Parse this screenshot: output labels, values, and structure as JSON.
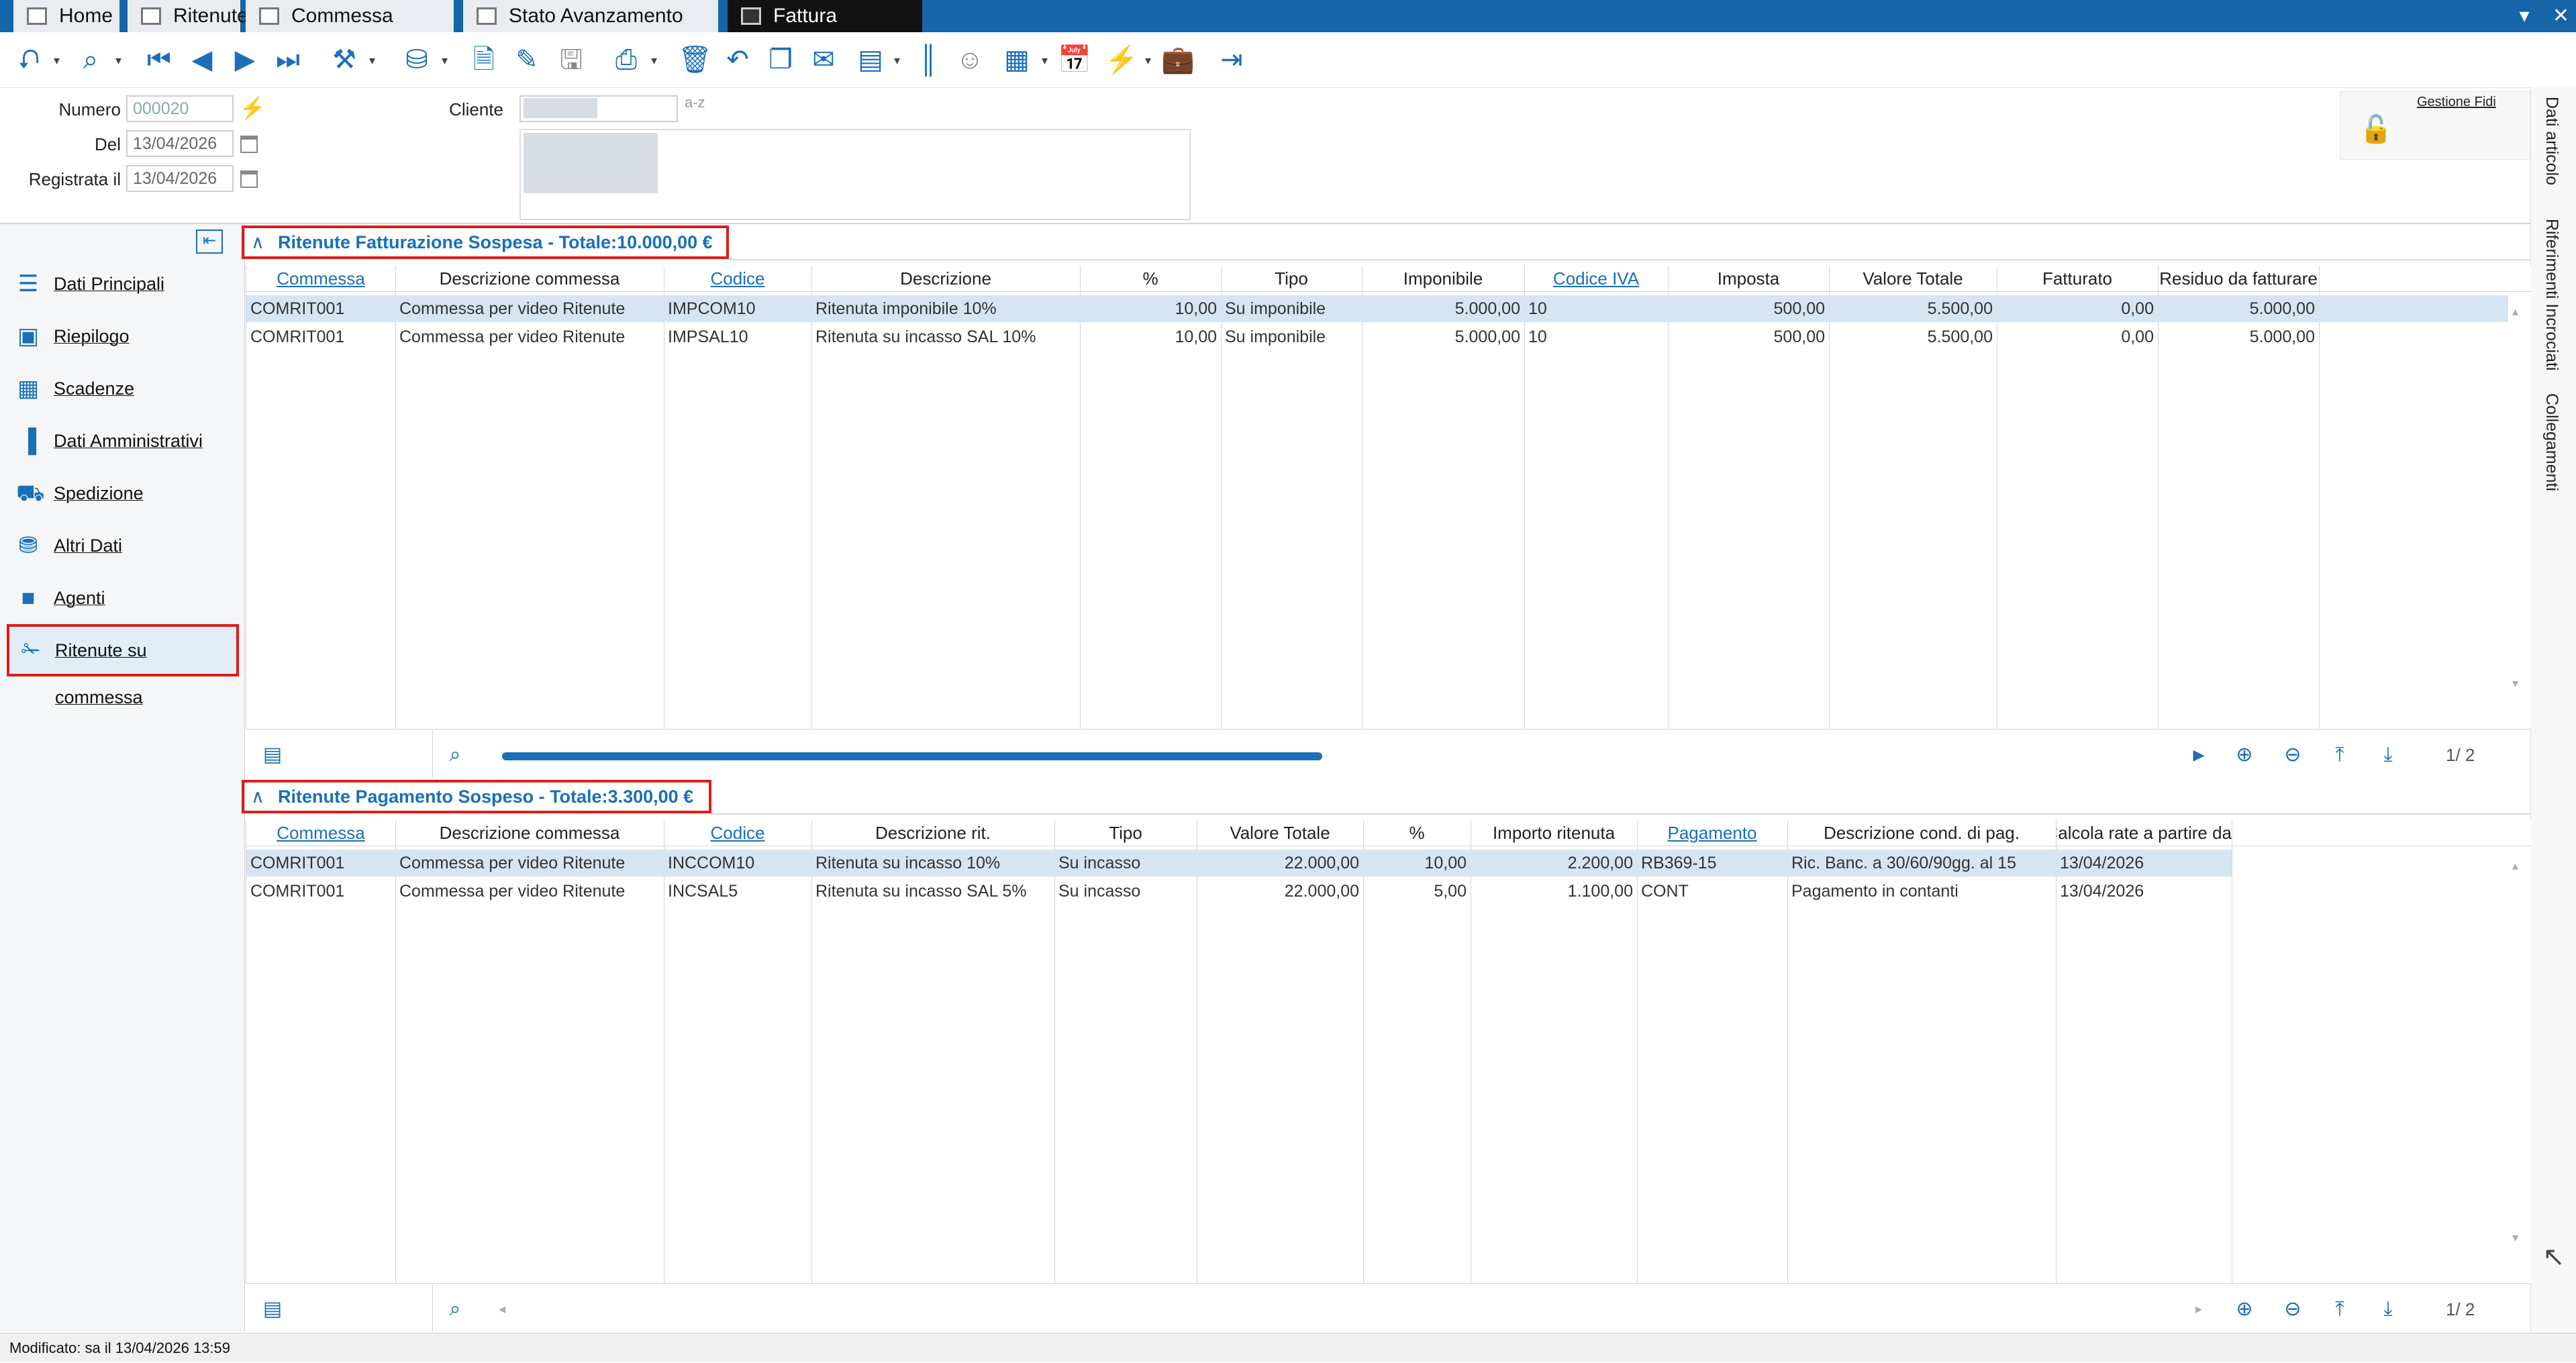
{
  "tabs": [
    {
      "label": "Home",
      "active": false
    },
    {
      "label": "Ritenute",
      "active": false
    },
    {
      "label": "Commessa Standard",
      "active": false
    },
    {
      "label": "Stato Avanzamento Lavori",
      "active": false
    },
    {
      "label": "Fattura Immediata",
      "active": true
    }
  ],
  "window_controls": {
    "chevron": "▾",
    "close": "✕"
  },
  "toolbar_icons": [
    "expand-icon",
    "search-icon",
    "first-icon",
    "prev-icon",
    "next-icon",
    "last-icon",
    "tools-icon",
    "database-icon",
    "new-document-icon",
    "edit-icon",
    "save-icon",
    "print-icon",
    "delete-icon",
    "undo-icon",
    "copy-icon",
    "mail-icon",
    "report-icon",
    "barcode-icon",
    "user-icon",
    "grid-icon",
    "calendar-icon",
    "lightning-icon",
    "briefcase-icon",
    "exit-icon"
  ],
  "header": {
    "numero_label": "Numero",
    "numero_value": "000020",
    "del_label": "Del",
    "del_value": "13/04/2026",
    "registrata_label": "Registrata il",
    "registrata_value": "13/04/2026",
    "cliente_label": "Cliente",
    "cliente_code_suffix": "a-z",
    "gestione_fidi": "Gestione Fidi"
  },
  "side_tabs": [
    "Dati articolo",
    "Riferimenti Incrociati",
    "Collegamenti"
  ],
  "nav": {
    "items": [
      {
        "label": "Dati Principali",
        "icon": "user-stack-icon"
      },
      {
        "label": "Riepilogo",
        "icon": "summary-icon"
      },
      {
        "label": "Scadenze",
        "icon": "calendar-icon"
      },
      {
        "label": "Dati Amministrativi",
        "icon": "chart-icon"
      },
      {
        "label": "Spedizione",
        "icon": "truck-icon"
      },
      {
        "label": "Altri Dati",
        "icon": "data-settings-icon"
      },
      {
        "label": "Agenti",
        "icon": "briefcase-icon"
      },
      {
        "label": "Ritenute su commessa",
        "icon": "ritenute-icon"
      }
    ],
    "selected": "Ritenute su commessa"
  },
  "section1": {
    "title": "Ritenute Fatturazione Sospesa - Totale:10.000,00 €",
    "columns": [
      "Commessa",
      "Descrizione commessa",
      "Codice",
      "Descrizione",
      "%",
      "Tipo",
      "Imponibile",
      "Codice IVA",
      "Imposta",
      "Valore Totale",
      "Fatturato",
      "Residuo da fatturare"
    ],
    "rows": [
      [
        "COMRIT001",
        "Commessa per video Ritenute",
        "IMPCOM10",
        "Ritenuta imponibile 10%",
        "10,00",
        "Su imponibile",
        "5.000,00",
        "10",
        "500,00",
        "5.500,00",
        "0,00",
        "5.000,00"
      ],
      [
        "COMRIT001",
        "Commessa per video Ritenute",
        "IMPSAL10",
        "Ritenuta su incasso SAL 10%",
        "10,00",
        "Su imponibile",
        "5.000,00",
        "10",
        "500,00",
        "5.500,00",
        "0,00",
        "5.000,00"
      ]
    ],
    "pager": "1/  2"
  },
  "section2": {
    "title": "Ritenute Pagamento Sospeso - Totale:3.300,00 €",
    "columns": [
      "Commessa",
      "Descrizione commessa",
      "Codice",
      "Descrizione rit.",
      "Tipo",
      "Valore Totale",
      "%",
      "Importo ritenuta",
      "Pagamento",
      "Descrizione cond. di pag.",
      "Calcola rate a partire da"
    ],
    "rows": [
      [
        "COMRIT001",
        "Commessa per video Ritenute",
        "INCCOM10",
        "Ritenuta su incasso 10%",
        "Su incasso",
        "22.000,00",
        "10,00",
        "2.200,00",
        "RB369-15",
        "Ric. Banc. a 30/60/90gg. al 15",
        "13/04/2026"
      ],
      [
        "COMRIT001",
        "Commessa per video Ritenute",
        "INCSAL5",
        "Ritenuta su incasso SAL 5%",
        "Su incasso",
        "22.000,00",
        "5,00",
        "1.100,00",
        "CONT",
        "Pagamento in contanti",
        "13/04/2026"
      ]
    ],
    "pager": "1/  2"
  },
  "status": "Modificato: sa il 13/04/2026 13:59"
}
